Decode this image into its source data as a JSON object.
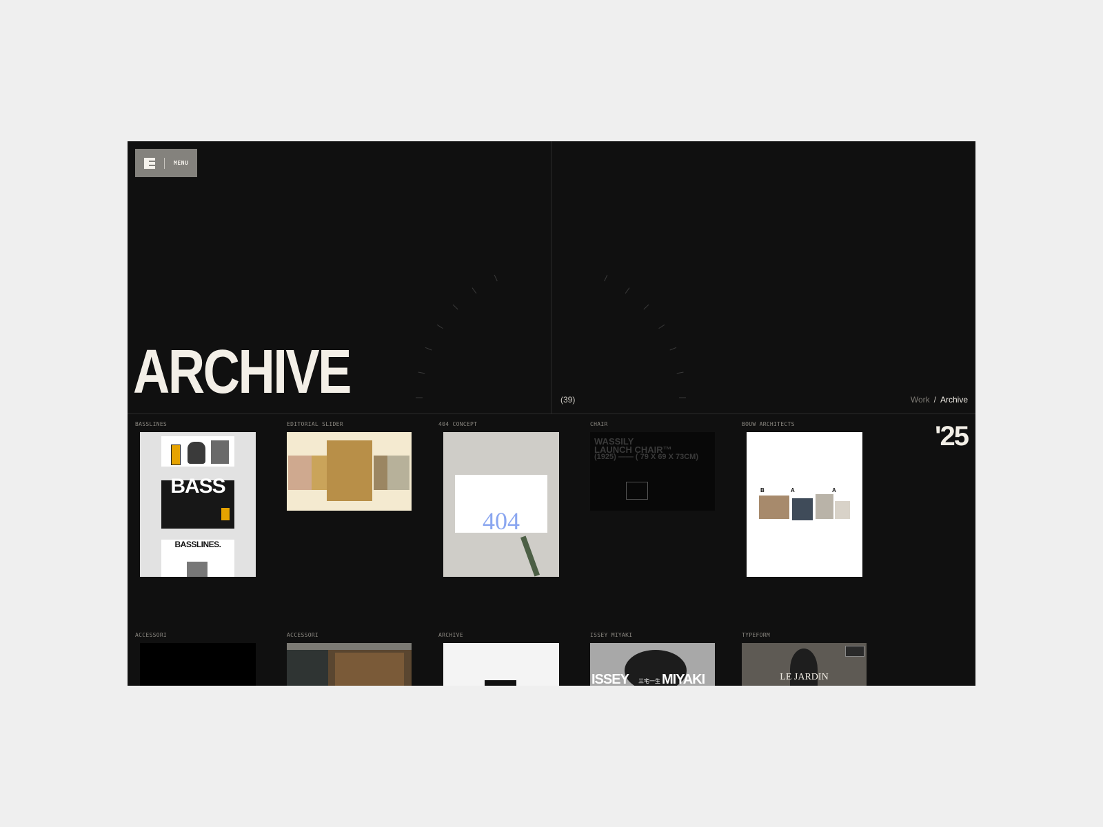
{
  "header": {
    "logo_icon": "e-logo-icon",
    "menu_label": "MENU",
    "title": "ARCHIVE",
    "count": "(39)",
    "breadcrumb": {
      "parent": "Work",
      "separator": "/",
      "current": "Archive"
    },
    "year": "'25"
  },
  "projects": [
    {
      "label": "BASSLINES",
      "thumb_text": [
        "BASS",
        "BASSLINES."
      ]
    },
    {
      "label": "EDITORIAL SLIDER"
    },
    {
      "label": "404 CONCEPT",
      "thumb_text": [
        "404"
      ]
    },
    {
      "label": "CHAIR",
      "thumb_text": [
        "WASSILY",
        "LAUNCH CHAIR™",
        "(1925) —— ( 79 X 69 X 73CM)"
      ]
    },
    {
      "label": "BOUW ARCHITECTS",
      "thumb_text": [
        "B",
        "A",
        "A"
      ]
    },
    {
      "label": "ACCESSORI"
    },
    {
      "label": "ACCESSORI"
    },
    {
      "label": "ARCHIVE"
    },
    {
      "label": "ISSEY MIYAKI",
      "thumb_text": [
        "ISSEY",
        "三宅一生",
        "MIYAKI"
      ]
    },
    {
      "label": "TYPEFORM",
      "thumb_text": [
        "LE JARDIN"
      ]
    }
  ],
  "colors": {
    "page_bg": "#efefef",
    "window_bg": "#101010",
    "accent_gray": "#84827d",
    "text_light": "#f3efe7"
  }
}
